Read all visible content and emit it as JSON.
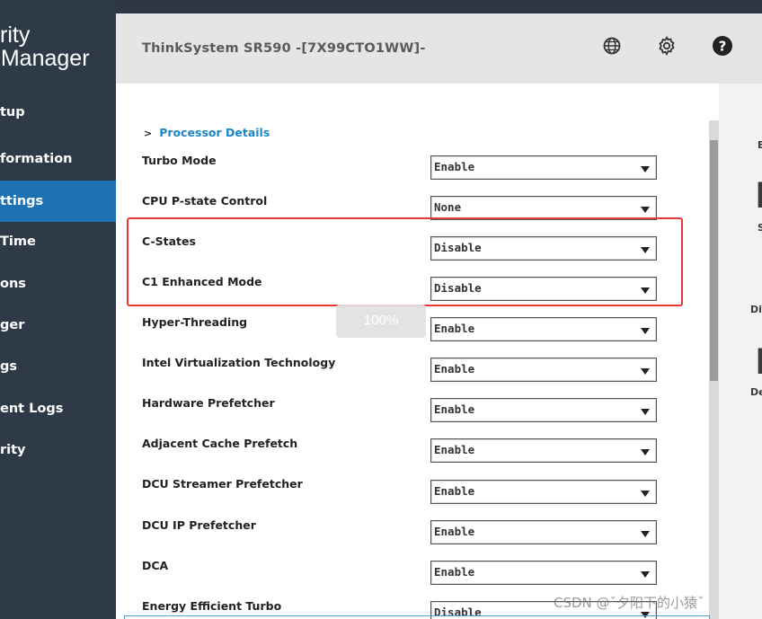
{
  "sidebar": {
    "brand_line1": "rity",
    "brand_line2": "g Manager",
    "items": [
      {
        "label": "tup"
      },
      {
        "label": "formation"
      },
      {
        "label": "ttings"
      },
      {
        "label": "Time"
      },
      {
        "label": "ons"
      },
      {
        "label": "ger"
      },
      {
        "label": "gs"
      },
      {
        "label": "ent Logs"
      },
      {
        "label": "rity"
      }
    ]
  },
  "header": {
    "title": "ThinkSystem SR590 -[7X99CTO1WW]-",
    "icons": [
      "globe-icon",
      "gear-icon",
      "help-icon"
    ]
  },
  "main": {
    "section_title": "Processor Details",
    "rows": [
      {
        "label": "Turbo Mode",
        "value": "Enable"
      },
      {
        "label": "CPU P-state Control",
        "value": "None"
      },
      {
        "label": "C-States",
        "value": "Disable"
      },
      {
        "label": "C1 Enhanced Mode",
        "value": "Disable"
      },
      {
        "label": "Hyper-Threading",
        "value": "Enable"
      },
      {
        "label": "Intel Virtualization Technology",
        "value": "Enable"
      },
      {
        "label": "Hardware Prefetcher",
        "value": "Enable"
      },
      {
        "label": "Adjacent Cache Prefetch",
        "value": "Enable"
      },
      {
        "label": "DCU Streamer Prefetcher",
        "value": "Enable"
      },
      {
        "label": "DCU IP Prefetcher",
        "value": "Enable"
      },
      {
        "label": "DCA",
        "value": "Enable"
      },
      {
        "label": "Energy Efficient Turbo",
        "value": "Disable"
      }
    ]
  },
  "zoom": "100%",
  "right_panel": {
    "items": [
      "E",
      "S",
      "Di",
      "De"
    ]
  },
  "watermark": "CSDN @ˇ夕阳下的小猿ˇ",
  "colors": {
    "sidebar_bg": "#2f3a48",
    "sidebar_active": "#1c72b3",
    "link_blue": "#1c86c6",
    "highlight_red": "#e53935"
  }
}
